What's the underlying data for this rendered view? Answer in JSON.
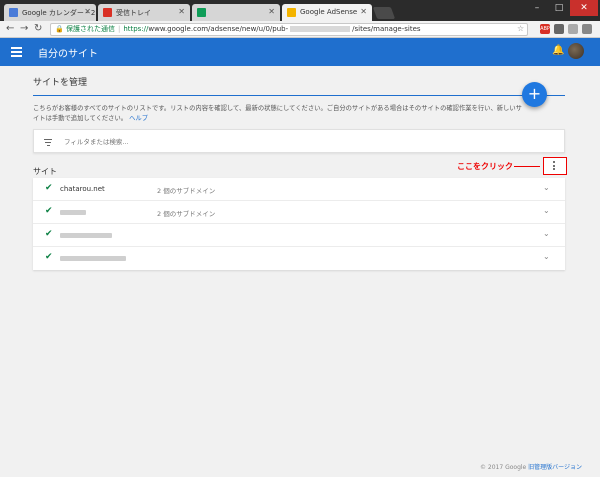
{
  "browser": {
    "tabs": [
      {
        "title": "Google カレンダー - 2",
        "favicon_color": "#4a7bd8"
      },
      {
        "title": "受信トレイ",
        "favicon_color": "#d93025"
      },
      {
        "title": "",
        "favicon_color": "#0f9d58"
      },
      {
        "title": "Google AdSense",
        "favicon_color": "#f4b400"
      }
    ],
    "window_buttons": [
      "–",
      "□",
      "✕"
    ],
    "secure_label": "保護された通信",
    "url_scheme": "https://",
    "url_host": "www.google.com",
    "url_path_start": "/adsense/new/u/0/pub-",
    "url_path_end": "/sites/manage-sites",
    "extensions": [
      "ABP",
      "",
      "",
      ""
    ]
  },
  "app": {
    "title": "自分のサイト",
    "card_title": "サイトを管理",
    "description": "こちらがお客様のすべてのサイトのリストです。リストの内容を確認して、最新の状態にしてください。ご自分のサイトがある場合はそのサイトの確認作業を行い、新しいサイトは手動で追加してください。",
    "help_link": "ヘルプ",
    "filter_placeholder": "フィルタまたは検索...",
    "sites_label": "サイト",
    "annotation": "ここをクリック",
    "sites": [
      {
        "name": "chatarou.net",
        "subdomains": "2 個のサブドメイン"
      },
      {
        "name": "",
        "subdomains": "2 個のサブドメイン"
      },
      {
        "name": "",
        "subdomains": ""
      },
      {
        "name": "",
        "subdomains": ""
      }
    ],
    "footer_copyright": "© 2017 Google",
    "footer_link": "旧管理版バージョン"
  },
  "colors": {
    "appbar": "#1f6fce",
    "accent": "#1f78e0",
    "check": "#0b8043",
    "annotation": "#ee0000"
  }
}
